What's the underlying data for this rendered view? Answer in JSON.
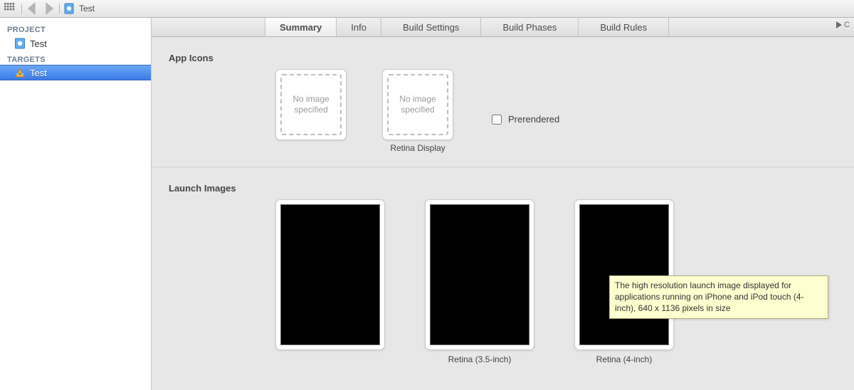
{
  "chrome": {
    "breadcrumb_project": "Test"
  },
  "sidebar": {
    "headings": {
      "project": "PROJECT",
      "targets": "TARGETS"
    },
    "project_item": "Test",
    "target_item": "Test"
  },
  "tabs": {
    "summary": "Summary",
    "info": "Info",
    "build_settings": "Build Settings",
    "build_phases": "Build Phases",
    "build_rules": "Build Rules"
  },
  "play_trailing": "C",
  "appIcons": {
    "title": "App Icons",
    "placeholder": "No image specified",
    "captions": {
      "std": "",
      "retina": "Retina Display"
    },
    "prerendered_label": "Prerendered"
  },
  "launch": {
    "title": "Launch Images",
    "captions": {
      "std": "",
      "retina35": "Retina (3.5-inch)",
      "retina4": "Retina (4-inch)"
    }
  },
  "tooltip": "The high resolution launch image displayed for applications running on iPhone and iPod touch (4-inch), 640 x 1136 pixels in size"
}
